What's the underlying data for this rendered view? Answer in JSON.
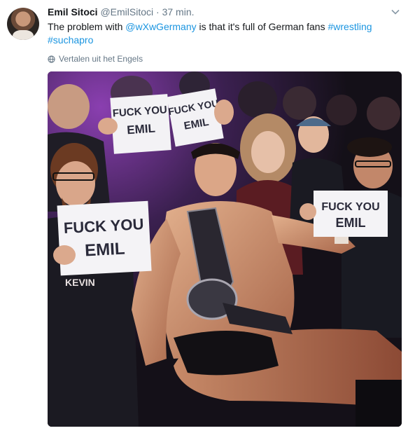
{
  "tweet": {
    "author_name": "Emil Sitoci",
    "author_handle": "@EmilSitoci",
    "separator": "·",
    "time": "37 min.",
    "text_parts": {
      "p1": "The problem with ",
      "mention": "@wXwGermany",
      "p2": " is that it's full of German fans ",
      "hashtag1": "#wrestling",
      "hashtag2": "#suchapro"
    },
    "translate_label": "Vertalen uit het Engels",
    "icons": {
      "avatar": "avatar",
      "menu": "chevron-down-icon",
      "translate": "globe-icon"
    }
  },
  "photo": {
    "signs": {
      "sign1_line1": "FUCK YOU",
      "sign1_line2": "EMIL",
      "sign2_line1": "FUCK YOU",
      "sign2_line2": "EMIL",
      "sign3_line1": "FUCK YOU",
      "sign3_line2": "EMIL",
      "sign4_line1": "FUCK YOU",
      "sign4_line2": "EMIL"
    },
    "shirt_text": "KEVIN"
  },
  "colors": {
    "link": "#1b95e0",
    "secondary_text": "#657786",
    "primary_text": "#14171a"
  }
}
